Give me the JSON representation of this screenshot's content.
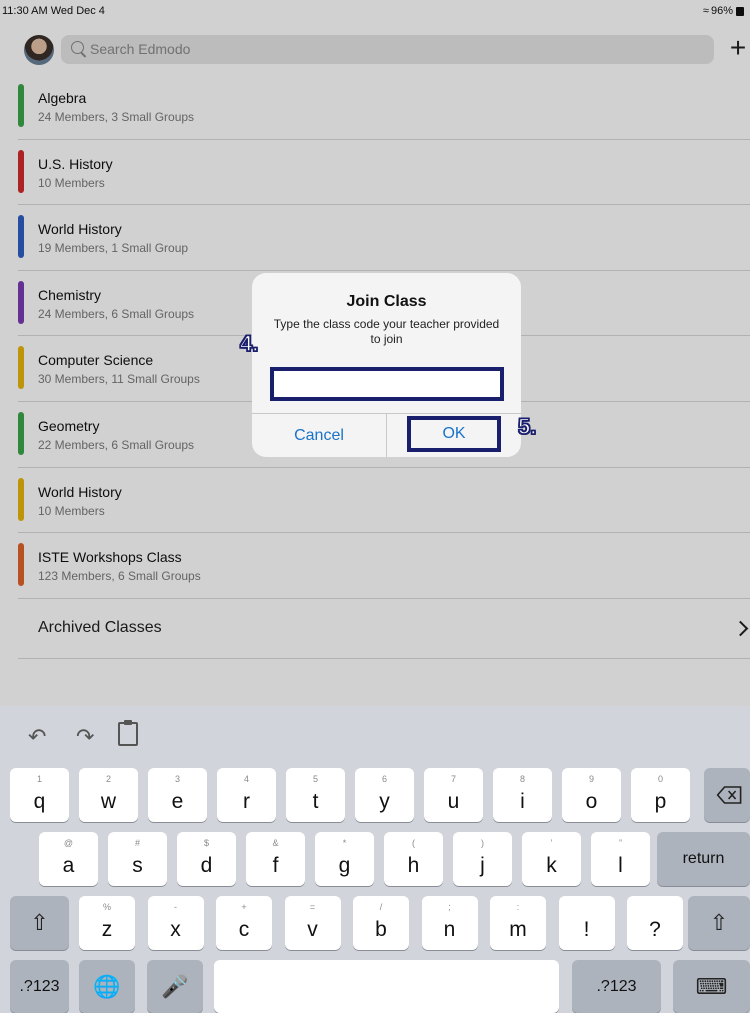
{
  "status_bar": {
    "time": "11:30 AM  Wed Dec 4",
    "battery": "96%"
  },
  "header": {
    "search_placeholder": "Search Edmodo",
    "add_label": "+"
  },
  "classes": [
    {
      "name": "Algebra",
      "meta": "24 Members, 3 Small Groups",
      "color": "#3aa648"
    },
    {
      "name": "U.S. History",
      "meta": "10 Members",
      "color": "#d42a2a"
    },
    {
      "name": "World History",
      "meta": "19 Members, 1 Small Group",
      "color": "#2f5fc4"
    },
    {
      "name": "Chemistry",
      "meta": "24 Members, 6 Small Groups",
      "color": "#7b3bb5"
    },
    {
      "name": "Computer Science",
      "meta": "30 Members, 11 Small Groups",
      "color": "#e8b60c"
    },
    {
      "name": "Geometry",
      "meta": "22 Members, 6 Small Groups",
      "color": "#3aa648"
    },
    {
      "name": "World History",
      "meta": "10 Members",
      "color": "#e8b60c"
    },
    {
      "name": "ISTE Workshops Class",
      "meta": "123 Members, 6 Small Groups",
      "color": "#e0632a"
    }
  ],
  "archived": {
    "label": "Archived Classes"
  },
  "dialog": {
    "title": "Join Class",
    "message": "Type the class code your teacher provided to join",
    "input_value": "",
    "cancel_label": "Cancel",
    "ok_label": "OK"
  },
  "annotations": {
    "step4": "4.",
    "step5": "5."
  },
  "keyboard": {
    "row1": [
      {
        "main": "q",
        "sub": "1"
      },
      {
        "main": "w",
        "sub": "2"
      },
      {
        "main": "e",
        "sub": "3"
      },
      {
        "main": "r",
        "sub": "4"
      },
      {
        "main": "t",
        "sub": "5"
      },
      {
        "main": "y",
        "sub": "6"
      },
      {
        "main": "u",
        "sub": "7"
      },
      {
        "main": "i",
        "sub": "8"
      },
      {
        "main": "o",
        "sub": "9"
      },
      {
        "main": "p",
        "sub": "0"
      }
    ],
    "row2": [
      {
        "main": "a",
        "sub": "@"
      },
      {
        "main": "s",
        "sub": "#"
      },
      {
        "main": "d",
        "sub": "$"
      },
      {
        "main": "f",
        "sub": "&"
      },
      {
        "main": "g",
        "sub": "*"
      },
      {
        "main": "h",
        "sub": "("
      },
      {
        "main": "j",
        "sub": ")"
      },
      {
        "main": "k",
        "sub": "’"
      },
      {
        "main": "l",
        "sub": "”"
      }
    ],
    "row3": [
      {
        "main": "z",
        "sub": "%"
      },
      {
        "main": "x",
        "sub": "-"
      },
      {
        "main": "c",
        "sub": "+"
      },
      {
        "main": "v",
        "sub": "="
      },
      {
        "main": "b",
        "sub": "/"
      },
      {
        "main": "n",
        "sub": ";"
      },
      {
        "main": "m",
        "sub": ":"
      },
      {
        "main": "!",
        "sub": ""
      },
      {
        "main": "?",
        "sub": ""
      }
    ],
    "return_label": "return",
    "numbers_label": ".?123"
  }
}
